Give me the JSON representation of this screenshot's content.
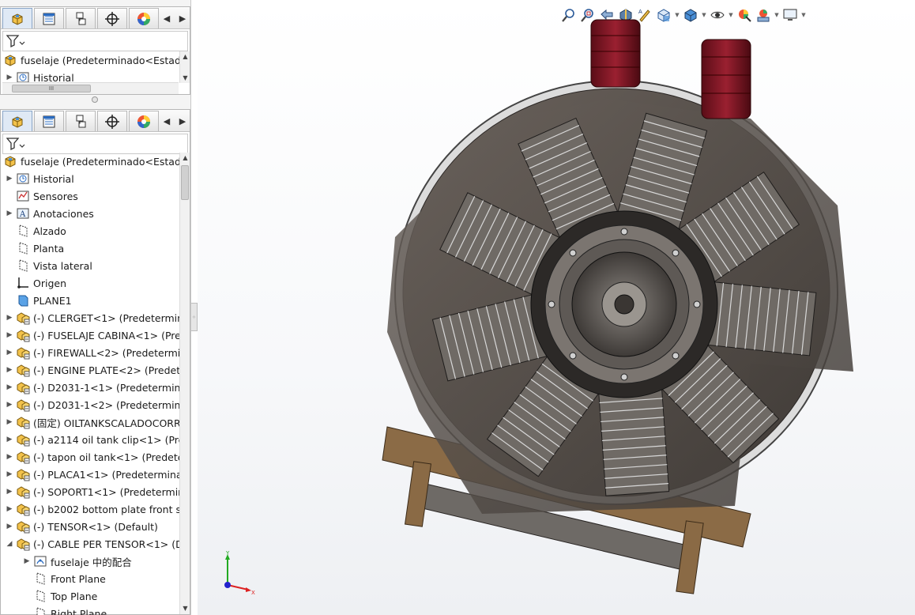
{
  "colors": {
    "panel_bg": "#f4f4f4",
    "selection_blue": "#dfe9f5",
    "engine_dark": "#5c5550",
    "engine_plate": "#4e4945",
    "cylinder_red": "#7a1420",
    "wood": "#8a6a45",
    "axis_x": "#d22",
    "axis_y": "#2a2",
    "axis_z": "#22c"
  },
  "manager_tabs": [
    {
      "icon": "feature-manager-icon",
      "active": true
    },
    {
      "icon": "property-manager-icon"
    },
    {
      "icon": "configuration-manager-icon"
    },
    {
      "icon": "dimxpert-manager-icon"
    },
    {
      "icon": "display-manager-icon"
    }
  ],
  "top_pane": {
    "root_label": "fuselaje  (Predeterminado<Estado",
    "items": [
      {
        "label": "Historial",
        "icon": "history-icon"
      }
    ]
  },
  "tree": {
    "root_label": "fuselaje  (Predeterminado<Estado",
    "items": [
      {
        "label": "Historial",
        "icon": "history-icon",
        "expander": "▶",
        "indent": 0
      },
      {
        "label": "Sensores",
        "icon": "sensor-icon",
        "expander": "",
        "indent": 0
      },
      {
        "label": "Anotaciones",
        "icon": "annotations-icon",
        "expander": "▶",
        "indent": 0
      },
      {
        "label": "Alzado",
        "icon": "plane-icon",
        "expander": "",
        "indent": 0
      },
      {
        "label": "Planta",
        "icon": "plane-icon",
        "expander": "",
        "indent": 0
      },
      {
        "label": "Vista lateral",
        "icon": "plane-icon",
        "expander": "",
        "indent": 0
      },
      {
        "label": "Origen",
        "icon": "origin-icon",
        "expander": "",
        "indent": 0
      },
      {
        "label": "PLANE1",
        "icon": "plane-blue-icon",
        "expander": "",
        "indent": 0
      },
      {
        "label": "(-) CLERGET<1> (Predetermin",
        "icon": "subassembly-icon",
        "expander": "▶",
        "indent": 0
      },
      {
        "label": "(-) FUSELAJE CABINA<1> (Pre",
        "icon": "subassembly-icon",
        "expander": "▶",
        "indent": 0
      },
      {
        "label": "(-) FIREWALL<2> (Predetermir",
        "icon": "subassembly-icon",
        "expander": "▶",
        "indent": 0
      },
      {
        "label": "(-) ENGINE PLATE<2> (Predet",
        "icon": "subassembly-icon",
        "expander": "▶",
        "indent": 0
      },
      {
        "label": "(-) D2031-1<1> (Predetermina",
        "icon": "subassembly-icon",
        "expander": "▶",
        "indent": 0
      },
      {
        "label": "(-) D2031-1<2> (Predetermina",
        "icon": "subassembly-icon",
        "expander": "▶",
        "indent": 0
      },
      {
        "label": "(固定) OILTANKSCALADOCORR",
        "icon": "subassembly-icon",
        "expander": "▶",
        "indent": 0
      },
      {
        "label": "(-) a2114 oil tank clip<1> (Pre",
        "icon": "subassembly-icon",
        "expander": "▶",
        "indent": 0
      },
      {
        "label": "(-) tapon oil tank<1> (Predete",
        "icon": "subassembly-icon",
        "expander": "▶",
        "indent": 0
      },
      {
        "label": "(-) PLACA1<1> (Predeterminac",
        "icon": "subassembly-icon",
        "expander": "▶",
        "indent": 0
      },
      {
        "label": "(-) SOPORT1<1> (Predetermin",
        "icon": "subassembly-icon",
        "expander": "▶",
        "indent": 0
      },
      {
        "label": "(-) b2002 bottom plate front s",
        "icon": "subassembly-icon",
        "expander": "▶",
        "indent": 0
      },
      {
        "label": "(-) TENSOR<1> (Default)",
        "icon": "subassembly-icon",
        "expander": "▶",
        "indent": 0
      },
      {
        "label": "(-) CABLE PER TENSOR<1> (D",
        "icon": "subassembly-icon",
        "expander": "◢",
        "indent": 0
      },
      {
        "label": "fuselaje 中的配合",
        "icon": "mates-icon",
        "expander": "▶",
        "indent": 1
      },
      {
        "label": "Front Plane",
        "icon": "plane-icon",
        "expander": "",
        "indent": 1
      },
      {
        "label": "Top Plane",
        "icon": "plane-icon",
        "expander": "",
        "indent": 1
      },
      {
        "label": "Right Plane",
        "icon": "plane-icon",
        "expander": "",
        "indent": 1
      }
    ]
  },
  "hscroll_label": "III",
  "heads_up_toolbar": [
    {
      "name": "zoom-to-fit-icon",
      "drop": false
    },
    {
      "name": "zoom-to-area-icon",
      "drop": false
    },
    {
      "name": "previous-view-icon",
      "drop": false
    },
    {
      "name": "section-view-icon",
      "drop": false
    },
    {
      "name": "dynamic-annotation-icon",
      "drop": false
    },
    {
      "name": "view-orientation-icon",
      "drop": true
    },
    {
      "name": "display-style-icon",
      "drop": true
    },
    {
      "name": "hide-show-items-icon",
      "drop": true
    },
    {
      "name": "edit-appearance-icon",
      "drop": false
    },
    {
      "name": "apply-scene-icon",
      "drop": true
    },
    {
      "name": "view-settings-icon",
      "drop": true
    }
  ],
  "triad": {
    "x": "X",
    "y": "Y",
    "z": "Z"
  }
}
